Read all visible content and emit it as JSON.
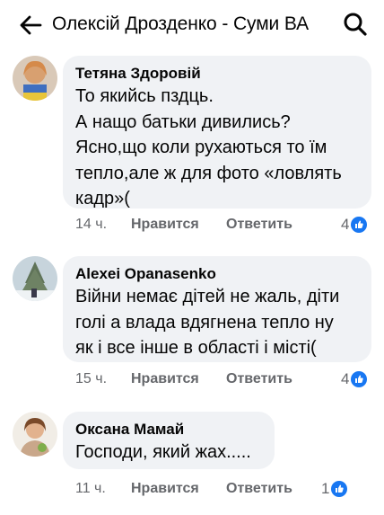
{
  "header": {
    "title": "Олексій Дрозденко - Суми ВА"
  },
  "comments": [
    {
      "author": "Тетяна Здоровій",
      "text": "То якийсь пздць.\nА нащо батьки дивились?\nЯсно,що коли рухаються то їм\nтепло,але ж для фото «ловлять\nкадр»(",
      "time": "14 ч.",
      "like_label": "Нравится",
      "reply_label": "Ответить",
      "reactions": "4"
    },
    {
      "author": "Alexei Opanasenko",
      "text": "Війни немає дітей не жаль, діти\nголі а влада вдягнена тепло ну\nяк і все інше в області і місті(",
      "time": "15 ч.",
      "like_label": "Нравится",
      "reply_label": "Ответить",
      "reactions": "4"
    },
    {
      "author": "Оксана Мамай",
      "text": "Господи, який жах.....",
      "time": "11 ч.",
      "like_label": "Нравится",
      "reply_label": "Ответить",
      "reactions": "1"
    }
  ],
  "colors": {
    "bubble": "#f0f2f5",
    "meta_text": "#65676b",
    "like_blue": "#1877f2"
  },
  "icons": {
    "back": "arrow-left-icon",
    "search": "search-icon",
    "reaction": "like-thumb-icon"
  }
}
